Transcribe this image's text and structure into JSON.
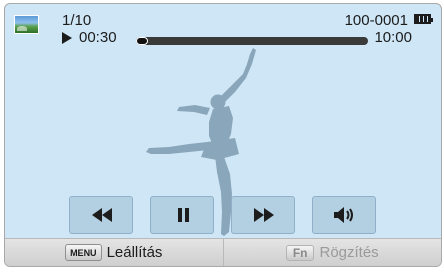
{
  "status": {
    "counter": "1/10",
    "elapsed": "00:30",
    "total": "10:00",
    "file_number": "100-0001",
    "progress": 0.05
  },
  "controls": [
    {
      "name": "rewind-button",
      "icon": "rewind-icon"
    },
    {
      "name": "pause-button",
      "icon": "pause-icon"
    },
    {
      "name": "fast-forward-button",
      "icon": "fast-forward-icon"
    },
    {
      "name": "volume-button",
      "icon": "speaker-icon"
    }
  ],
  "softkeys": {
    "menu_key": "MENU",
    "stop_label": "Leállítás",
    "fn_key": "Fn",
    "capture_label": "Rögzítés"
  },
  "colors": {
    "screen_bg": "#cfe6f6",
    "silhouette": "#8aa6ba",
    "bar_bg": "#dadada"
  }
}
